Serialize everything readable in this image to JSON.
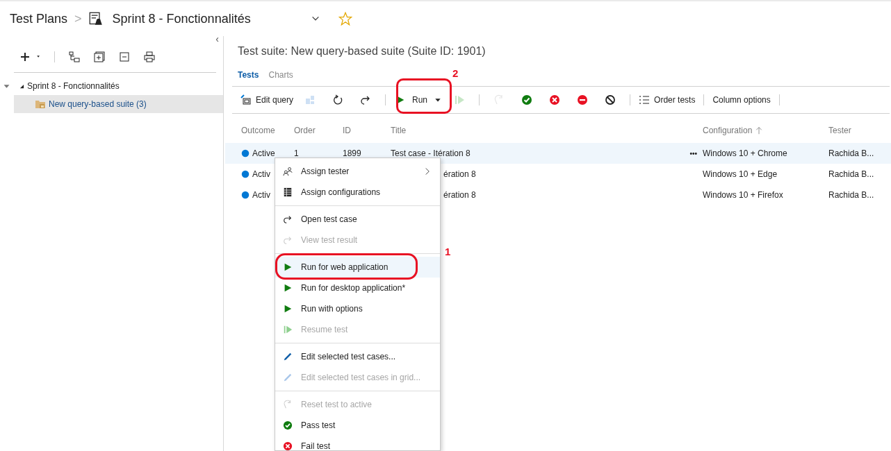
{
  "breadcrumb": {
    "root": "Test Plans",
    "separator": ">",
    "plan": "Sprint 8 - Fonctionnalités",
    "favorite": false
  },
  "left_panel": {
    "collapse": "‹",
    "tree": [
      {
        "label": "Sprint 8 - Fonctionnalités",
        "expanded": true,
        "selected": false,
        "children": [
          {
            "label": "New query-based suite (3)",
            "selected": true
          }
        ]
      }
    ]
  },
  "suite_title": "Test suite: New query-based suite (Suite ID: 1901)",
  "tabs": [
    {
      "label": "Tests",
      "selected": true
    },
    {
      "label": "Charts",
      "selected": false
    }
  ],
  "toolbar": [
    {
      "kind": "text",
      "label": "Edit query",
      "disabled": false
    },
    {
      "kind": "icon",
      "disabled": true
    },
    {
      "kind": "icon",
      "disabled": false
    },
    {
      "kind": "icon",
      "disabled": false
    },
    {
      "kind": "separator"
    },
    {
      "kind": "run",
      "label": "Run",
      "disabled": false
    },
    {
      "kind": "icon",
      "disabled": true
    },
    {
      "kind": "separator"
    },
    {
      "kind": "icon",
      "disabled": true
    },
    {
      "kind": "icon",
      "disabled": false
    },
    {
      "kind": "icon",
      "disabled": false
    },
    {
      "kind": "icon",
      "disabled": false
    },
    {
      "kind": "icon",
      "disabled": false
    },
    {
      "kind": "separator"
    },
    {
      "kind": "text",
      "label": "Order tests",
      "disabled": false
    },
    {
      "kind": "separator"
    },
    {
      "kind": "text",
      "label": "Column options",
      "disabled": false
    },
    {
      "kind": "separator"
    }
  ],
  "table": {
    "columns": [
      "Outcome",
      "Order",
      "ID",
      "Title",
      "Configuration",
      "Tester"
    ],
    "rows": [
      {
        "outcome": "Active",
        "order": "1",
        "id": "1899",
        "title": "Test case - Itération 8",
        "more": "•••",
        "configuration": "Windows 10 + Chrome",
        "tester": "Rachida B...",
        "selected": true
      },
      {
        "outcome": "Activ",
        "title": "ération 8",
        "configuration": "Windows 10 + Edge",
        "tester": "Rachida B...",
        "selected": false
      },
      {
        "outcome": "Activ",
        "title": "ération 8",
        "configuration": "Windows 10 + Firefox",
        "tester": "Rachida B...",
        "selected": false
      }
    ]
  },
  "context_menu": [
    {
      "kind": "item",
      "label": "Assign tester",
      "submenu": true,
      "disabled": false,
      "selected": false
    },
    {
      "kind": "item",
      "label": "Assign configurations",
      "submenu": false,
      "disabled": false,
      "selected": false
    },
    {
      "kind": "separator"
    },
    {
      "kind": "item",
      "label": "Open test case",
      "submenu": false,
      "disabled": false,
      "selected": false
    },
    {
      "kind": "item",
      "label": "View test result",
      "submenu": false,
      "disabled": true,
      "selected": false
    },
    {
      "kind": "separator"
    },
    {
      "kind": "item",
      "label": "Run for web application",
      "submenu": false,
      "disabled": false,
      "selected": true
    },
    {
      "kind": "item",
      "label": "Run for desktop application*",
      "submenu": false,
      "disabled": false,
      "selected": false
    },
    {
      "kind": "item",
      "label": "Run with options",
      "submenu": false,
      "disabled": false,
      "selected": false
    },
    {
      "kind": "item",
      "label": "Resume test",
      "submenu": false,
      "disabled": true,
      "selected": false
    },
    {
      "kind": "separator"
    },
    {
      "kind": "item",
      "label": "Edit selected test cases...",
      "submenu": false,
      "disabled": false,
      "selected": false
    },
    {
      "kind": "item",
      "label": "Edit selected test cases in grid...",
      "submenu": false,
      "disabled": true,
      "selected": false
    },
    {
      "kind": "separator"
    },
    {
      "kind": "item",
      "label": "Reset test to active",
      "submenu": false,
      "disabled": true,
      "selected": false
    },
    {
      "kind": "item",
      "label": "Pass test",
      "submenu": false,
      "disabled": false,
      "selected": false
    },
    {
      "kind": "item",
      "label": "Fail test",
      "submenu": false,
      "disabled": false,
      "selected": false
    }
  ],
  "annotations": [
    {
      "kind": "menu",
      "label": "1"
    },
    {
      "kind": "toolbar",
      "label": "2"
    }
  ]
}
